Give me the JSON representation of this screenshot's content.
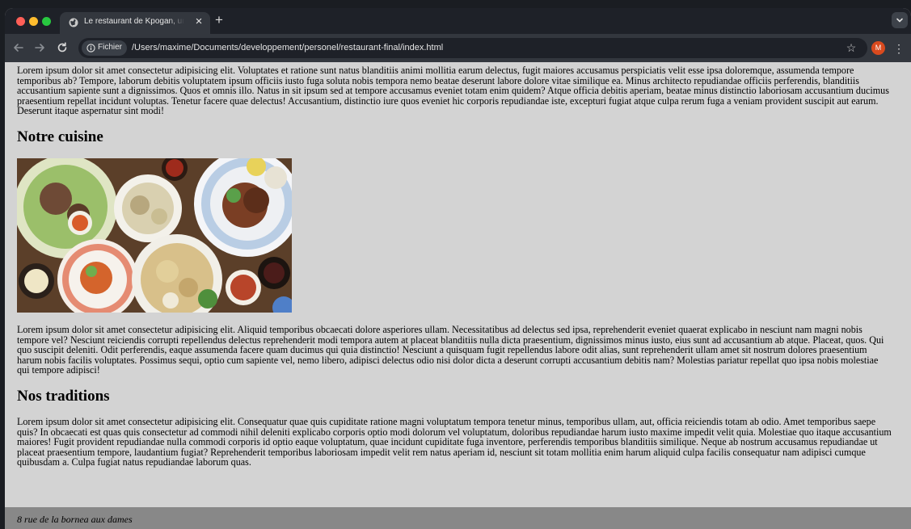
{
  "browser": {
    "tab": {
      "title": "Le restaurant de Kpogan, un re"
    },
    "address_bar": {
      "scheme_label": "Fichier",
      "url": "/Users/maxime/Documents/developpement/personel/restaurant-final/index.html"
    },
    "profile_initial": "M"
  },
  "page": {
    "intro": "Lorem ipsum dolor sit amet consectetur adipisicing elit. Voluptates et ratione sunt natus blanditiis animi mollitia earum delectus, fugit maiores accusamus perspiciatis velit esse ipsa doloremque, assumenda tempore temporibus ab? Tempore, laborum debitis voluptatem ipsum officiis iusto fuga soluta nobis tempora nemo beatae deserunt labore dolore vitae similique ea. Minus architecto repudiandae officiis perferendis, blanditiis accusantium sapiente sunt a dignissimos. Quos et omnis illo. Natus in sit ipsum sed at tempore accusamus eveniet totam enim quidem? Atque officia debitis aperiam, beatae minus distinctio laboriosam accusantium ducimus praesentium repellat incidunt voluptas. Tenetur facere quae delectus! Accusantium, distinctio iure quos eveniet hic corporis repudiandae iste, excepturi fugiat atque culpa rerum fuga a veniam provident suscipit aut earum. Deserunt itaque aspernatur sint modi!",
    "section_cuisine": {
      "heading": "Notre cuisine",
      "text": "Lorem ipsum dolor sit amet consectetur adipisicing elit. Aliquid temporibus obcaecati dolore asperiores ullam. Necessitatibus ad delectus sed ipsa, reprehenderit eveniet quaerat explicabo in nesciunt nam magni nobis tempore vel? Nesciunt reiciendis corrupti repellendus delectus reprehenderit modi tempora autem at placeat blanditiis nulla dicta praesentium, dignissimos minus iusto, eius sunt ad accusantium ab atque. Placeat, quos. Qui quo suscipit deleniti. Odit perferendis, eaque assumenda facere quam ducimus qui quia distinctio! Nesciunt a quisquam fugit repellendus labore odit alias, sunt reprehenderit ullam amet sit nostrum dolores praesentium harum nobis facilis voluptates. Possimus sequi, optio cum sapiente vel, nemo libero, adipisci delectus odio nisi dolor dicta a deserunt corrupti accusantium debitis nam? Molestias pariatur repellat quo ipsa nobis molestiae qui tempore adipisci!"
    },
    "section_traditions": {
      "heading": "Nos traditions",
      "text": "Lorem ipsum dolor sit amet consectetur adipisicing elit. Consequatur quae quis cupiditate ratione magni voluptatum tempora tenetur minus, temporibus ullam, aut, officia reiciendis totam ab odio. Amet temporibus saepe quis? In obcaecati est quas quis consectetur ad commodi nihil deleniti explicabo corporis optio modi dolorum vel voluptatum, doloribus repudiandae harum iusto maxime impedit velit quia. Molestiae quo itaque accusantium maiores! Fugit provident repudiandae nulla commodi corporis id optio eaque voluptatum, quae incidunt cupiditate fuga inventore, perferendis temporibus blanditiis similique. Neque ab nostrum accusamus repudiandae ut placeat praesentium tempore, laudantium fugiat? Reprehenderit temporibus laboriosam impedit velit rem natus aperiam id, nesciunt sit totam mollitia enim harum aliquid culpa facilis consequatur nam adipisci cumque quibusdam a. Culpa fugiat natus repudiandae laborum quas."
    },
    "footer": {
      "address": "8 rue de la bornea aux dames"
    }
  }
}
